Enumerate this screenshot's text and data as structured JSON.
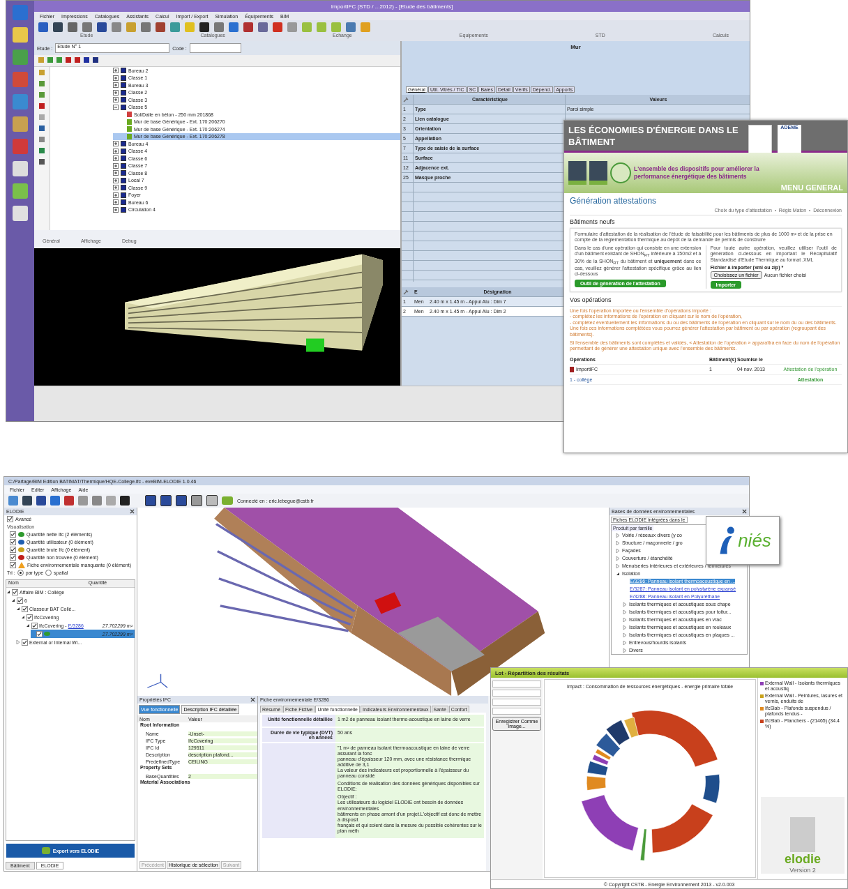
{
  "top_window": {
    "title": "ImportIFC (STD / ...2012) - [Etude des bâtiments]",
    "menu": [
      "Fichier",
      "Impressions",
      "Catalogues",
      "Assistants",
      "Calcul",
      "Import / Export",
      "Simulation",
      "Équipements",
      "BIM"
    ],
    "toolbar_groups": [
      "Etude",
      "Catalogues",
      "Echange",
      "Equipements",
      "STD",
      "Calculs"
    ],
    "etude_label": "Etude :",
    "etude_value": "Etude N° 1",
    "code_label": "Code :",
    "tree": [
      {
        "label": "Bureau 2",
        "expanded": false,
        "selected": false
      },
      {
        "label": "Classe 1",
        "expanded": false,
        "selected": false
      },
      {
        "label": "Bureau 3",
        "expanded": false,
        "selected": false
      },
      {
        "label": "Classe 2",
        "expanded": false,
        "selected": false
      },
      {
        "label": "Classe 3",
        "expanded": false,
        "selected": false
      },
      {
        "label": "Classe 5",
        "expanded": true,
        "selected": false,
        "children": [
          {
            "label": "Sol/Dalle en béton - 250 mm 201868",
            "kind": "slab",
            "selected": false
          },
          {
            "label": "Mur de base Générique - Ext. 170:206270",
            "kind": "wall",
            "selected": false
          },
          {
            "label": "Mur de base Générique - Ext. 170:206274",
            "kind": "wall",
            "selected": false
          },
          {
            "label": "Mur de base Générique - Ext. 170:206278",
            "kind": "wall",
            "selected": true
          }
        ]
      },
      {
        "label": "Bureau 4",
        "expanded": false,
        "selected": false
      },
      {
        "label": "Classe 4",
        "expanded": false,
        "selected": false
      },
      {
        "label": "Classe 6",
        "expanded": false,
        "selected": false
      },
      {
        "label": "Classe 7",
        "expanded": false,
        "selected": false
      },
      {
        "label": "Classe 8",
        "expanded": false,
        "selected": false
      },
      {
        "label": "Local 7",
        "expanded": false,
        "selected": false
      },
      {
        "label": "Classe 9",
        "expanded": false,
        "selected": false
      },
      {
        "label": "Foyer",
        "expanded": false,
        "selected": false
      },
      {
        "label": "Bureau 6",
        "expanded": false,
        "selected": false
      },
      {
        "label": "Circulation 4",
        "expanded": false,
        "selected": false
      }
    ],
    "view_toolbar": [
      "Général",
      "Affichage",
      "Debug"
    ],
    "panel_title": "Mur",
    "tabs": [
      {
        "label": "Général",
        "selected": true
      },
      {
        "label": "Util. Vitrés / TIC",
        "selected": false
      },
      {
        "label": "SC",
        "selected": false
      },
      {
        "label": "Baies",
        "selected": false
      },
      {
        "label": "Détail",
        "selected": false
      },
      {
        "label": "Vérifs",
        "selected": false
      },
      {
        "label": "Dépend.",
        "selected": false
      },
      {
        "label": "Apports",
        "selected": false
      }
    ],
    "table": {
      "columns": [
        "Caractéristique",
        "Valeurs"
      ],
      "rows": [
        {
          "num": "1",
          "name": "Type",
          "value": "Paroi simple"
        },
        {
          "num": "2",
          "name": "Lien catalogue"
        },
        {
          "num": "3",
          "name": "Orientation"
        },
        {
          "num": "5",
          "name": "Appellation"
        },
        {
          "num": "7",
          "name": "Type de saisie de la surface"
        },
        {
          "num": "11",
          "name": "Surface"
        },
        {
          "num": "12",
          "name": "Adjacence ext."
        },
        {
          "num": "25",
          "name": "Masque proche"
        }
      ]
    },
    "lower_table": {
      "columns": [
        "E",
        "Désignation"
      ],
      "rows": [
        {
          "num": "1",
          "type": "Men",
          "designation": "2.40 m x 1.45 m - Appui Alu : Dim 7",
          "selected": false
        },
        {
          "num": "2",
          "type": "Men",
          "designation": "2.40 m x 1.45 m - Appui Alu : Dim 2",
          "selected": true
        }
      ]
    }
  },
  "web_page": {
    "banner_title": "LES ÉCONOMIES D'ÉNERGIE DANS LE BÂTIMENT",
    "banner_tagline": "L'ensemble des dispositifs pour améliorer la performance énergétique des bâtiments",
    "partner": "ADEME",
    "menu_label": "MENU GENERAL",
    "heading": "Génération attestations",
    "links": [
      "Choix du type d'attestation",
      "Régis Maton",
      "Déconnexion"
    ],
    "section": "Bâtiments neufs",
    "intro": "Formulaire d'attestation de la réalisation de l'étude de faisabilité pour les bâtiments de plus de 1000 m² et de la prise en compte de la réglementation thermique au dépôt de la demande de permis de construire",
    "left_text": "Dans le cas d'une opération qui consiste en une extension d'un bâtiment existant de SHON$_{RT}$ inférieure à 150m2 et à 30% de la SHON$_{RT}$ du bâtiment et **uniquement** dans ce cas, veuillez générer l'attestation spécifique grâce au lien ci-dessous",
    "left_button": "Outil de génération de l'attestation",
    "right_text": "Pour toute autre opération, veuillez utiliser l'outil de génération ci-dessous en important le Récapitulatif Standardisé d'Etude Thermique au format .XML",
    "file_label": "Fichier à importer (xml ou zip) *",
    "file_button": "Choisissez un fichier",
    "file_status": "Aucun fichier choisi",
    "import_button": "Importer",
    "ops_heading": "Vos opérations",
    "ops_notes": [
      "Une fois l'opération importée ou l'ensemble d'opérations importé :",
      "- complétez les informations de l'opération en cliquant sur le nom de l'opération,",
      "- complétez éventuellement les informations du ou des bâtiments de l'opération en cliquant sur le nom du ou des bâtiments.",
      "Une fois ces informations complétées vous pourrez générer l'attestation par bâtiment ou par opération (regroupant des bâtiments).",
      "Si l'ensemble des bâtiments sont complétés et validés, « Attestation de l'opération » apparaîtra en face du nom de l'opération permettant de générer une attestation unique avec l'ensemble des bâtiments."
    ],
    "ops_columns": [
      "Opérations",
      "Bâtiment(s)",
      "Soumise le"
    ],
    "operation": {
      "name": "ImportIFC",
      "count": "1",
      "date": "04 nov. 2013",
      "action": "Attestation de l'opération"
    },
    "building": {
      "name": "1 - collège",
      "action": "Attestation"
    }
  },
  "bim_window": {
    "title": "C:/Partage/BIM Edition BATIMAT/Thermique/HQE-College.ifc - eveBIM-ELODIE 1.0.46",
    "menu": [
      "Fichier",
      "Editer",
      "Affichage",
      "Aide"
    ],
    "connection": "Connecté en : eric.lebegue@cstb.fr",
    "panel_title": "ELODIE",
    "advanced": {
      "label": "Avancé",
      "checked": true
    },
    "visualisation_label": "Visualisation",
    "legend": [
      {
        "label": "Quantité nette Ifc (2 éléments)",
        "checked": true,
        "kind": "dot",
        "color": "#2e9a2e"
      },
      {
        "label": "Quantité utilisateur (0 élément)",
        "checked": true,
        "kind": "dot",
        "color": "#1f5fb0"
      },
      {
        "label": "Quantité brute Ifc (0 élément)",
        "checked": true,
        "kind": "dot",
        "color": "#c9a21a"
      },
      {
        "label": "Quantité non trouvée (0 élément)",
        "checked": true,
        "kind": "dot",
        "color": "#c0201a"
      },
      {
        "label": "Fiche environnementale manquante (0 élément)",
        "checked": true,
        "kind": "warning"
      }
    ],
    "sort_label": "Tri :",
    "sort_options": [
      {
        "label": "par type",
        "selected": true
      },
      {
        "label": "spatial",
        "selected": false
      }
    ],
    "tree_columns": [
      "Nom",
      "Quantité"
    ],
    "tree": [
      {
        "label": "Affaire BIM : Collège",
        "checked": true,
        "expanded": true,
        "selected": false,
        "children": [
          {
            "label": "6",
            "checked": true,
            "expanded": true,
            "selected": false,
            "children": [
              {
                "label": "Classeur BAT Collè...",
                "checked": true,
                "expanded": true,
                "selected": false,
                "children": [
                  {
                    "label": "IfcCovering",
                    "checked": true,
                    "expanded": true,
                    "selected": false,
                    "children": [
                      {
                        "label": "IfcCovering - ",
                        "link": "E/3286",
                        "quantity": "27.702299 m²",
                        "checked": true,
                        "expanded": true,
                        "selected": false,
                        "children": [
                          {
                            "quantity": "27.702299 m²",
                            "checked": true,
                            "selected": true,
                            "color": "#2e9a2e"
                          }
                        ]
                      }
                    ]
                  }
                ]
              },
              {
                "label": "External or Internal Wi...",
                "checked": true,
                "expanded": false,
                "selected": false
              }
            ]
          }
        ]
      }
    ],
    "export_button": "Export vers ELODIE",
    "bottom_tabs": [
      {
        "label": "Bâtiment",
        "selected": false
      },
      {
        "label": "ELODIE",
        "selected": true
      }
    ],
    "props": {
      "title": "Propriétés IFC",
      "views": [
        {
          "label": "Vue fonctionnelle",
          "selected": true
        },
        {
          "label": "Description IFC détaillée",
          "selected": false
        }
      ],
      "columns": [
        "Nom",
        "Valeur"
      ],
      "groups": [
        {
          "label": "Root Information",
          "rows": [
            [
              "Name",
              "-Unset-"
            ],
            [
              "IFC Type",
              "IfcCovering"
            ],
            [
              "IFC Id",
              "129511"
            ],
            [
              "Description",
              "description plafond..."
            ],
            [
              "PredefinedType",
              "CEILING"
            ]
          ]
        },
        {
          "label": "Property Sets",
          "rows": [
            [
              "BaseQuantities",
              "2"
            ]
          ]
        },
        {
          "label": "Material Associations"
        }
      ],
      "nav": [
        {
          "label": "Précédent",
          "disabled": true
        },
        {
          "label": "Historique de sélection",
          "disabled": false
        },
        {
          "label": "Suivant",
          "disabled": true
        }
      ]
    },
    "sheet": {
      "title": "Fiche environnementale E/3286",
      "tabs": [
        {
          "label": "Résumé",
          "selected": false
        },
        {
          "label": "Fiche Fictive",
          "selected": false
        },
        {
          "label": "Unité fonctionnelle",
          "selected": true
        },
        {
          "label": "Indicateurs Environnementaux",
          "selected": false
        },
        {
          "label": "Santé",
          "selected": false
        },
        {
          "label": "Confort",
          "selected": false
        }
      ],
      "rows": [
        {
          "label": "Unité fonctionnelle détaillée",
          "paragraphs": [
            [
              "1 m2 de panneau isolant thermo-acoustique en laine de verre"
            ]
          ]
        },
        {
          "label": "Durée de vie typique (DVT) en années",
          "paragraphs": [
            [
              "50 ans"
            ]
          ]
        },
        {
          "paragraphs": [
            [
              "\"1 m² de panneau isolant thermoacoustique en laine de verre assurant la fonc",
              "panneau d'épaisseur 120 mm, avec une résistance thermique additive de 3,1",
              "La valeur des indicateurs est proportionnelle à l'épaisseur du panneau considé"
            ],
            [
              "Conditions de réalisation des données génériques disponibles sur ELODIE:"
            ],
            [
              "Objectif :",
              "Les utilisateurs du logiciel ELODIE ont besoin de données environnementales",
              "bâtiments en phase amont d'un projet.L'objectif est donc de mettre à disposit",
              "français et qui soient dans la mesure du possible cohérentes sur le plan méth"
            ]
          ]
        }
      ]
    },
    "db": {
      "title": "Bases de données environnementales",
      "source": "Fiches ELODIE intégrées dans le",
      "root": "Produit par famille",
      "items": [
        {
          "label": "Voirie / réseaux divers (y co",
          "expanded": false
        },
        {
          "label": "Structure / maçonnerie / gro",
          "expanded": false
        },
        {
          "label": "Façades",
          "expanded": false
        },
        {
          "label": "Couverture / étanchéité",
          "expanded": false
        },
        {
          "label": "Menuiseries intérieures et extérieures / fermetures",
          "expanded": false
        },
        {
          "label": "Isolation",
          "expanded": true,
          "children": [
            {
              "label": "E/3286: Panneau isolant thermoacoustique en ...",
              "kind": "sheet",
              "selected": true
            },
            {
              "label": "E/3287: Panneau isolant en polystyrène expansé",
              "kind": "sheet",
              "selected": false
            },
            {
              "label": "E/3288: Panneau isolant en Polyuréthane",
              "kind": "sheet",
              "selected": false
            },
            {
              "label": "Isolants thermiques et acoustiques sous chape",
              "kind": "folder",
              "selected": false
            },
            {
              "label": "Isolants thermiques et acoustiques pour toitur...",
              "kind": "folder",
              "selected": false
            },
            {
              "label": "Isolants thermiques et acoustiques en vrac",
              "kind": "folder",
              "selected": false
            },
            {
              "label": "Isolants thermiques et acoustiques en rouleaux",
              "kind": "folder",
              "selected": false
            },
            {
              "label": "Isolants thermiques et acoustiques en plaques ...",
              "kind": "folder",
              "selected": false
            },
            {
              "label": "Entrevous/hourdis isolants",
              "kind": "folder",
              "selected": false
            },
            {
              "label": "Divers",
              "kind": "folder",
              "selected": false
            }
          ]
        }
      ]
    },
    "logo_text": "niés"
  },
  "results_window": {
    "title": "Lot - Répartition des résultats",
    "save_button": "Enregistrer Comme Image...",
    "chart_title": "Impact : Consommation de ressources énergétiques - énergie primaire totale",
    "legend": [
      {
        "label": "External Wall - Isolants thermiques et acoustiq",
        "color": "#8e3fb5"
      },
      {
        "label": "External Wall - Peintures, lasures et vernis, enduits de",
        "color": "#c9a21a"
      },
      {
        "label": "IfcSlab - Plafonds suspendus / plafonds tendus -",
        "color": "#e08a20"
      },
      {
        "label": "IfcSlab - Planchers - (21465) (34.4 %)",
        "color": "#c8401c"
      }
    ],
    "logo_text": "elodie",
    "version": "Version 2",
    "footer": "© Copyright CSTB - Energie Environnement 2013 - v2.0.003"
  }
}
